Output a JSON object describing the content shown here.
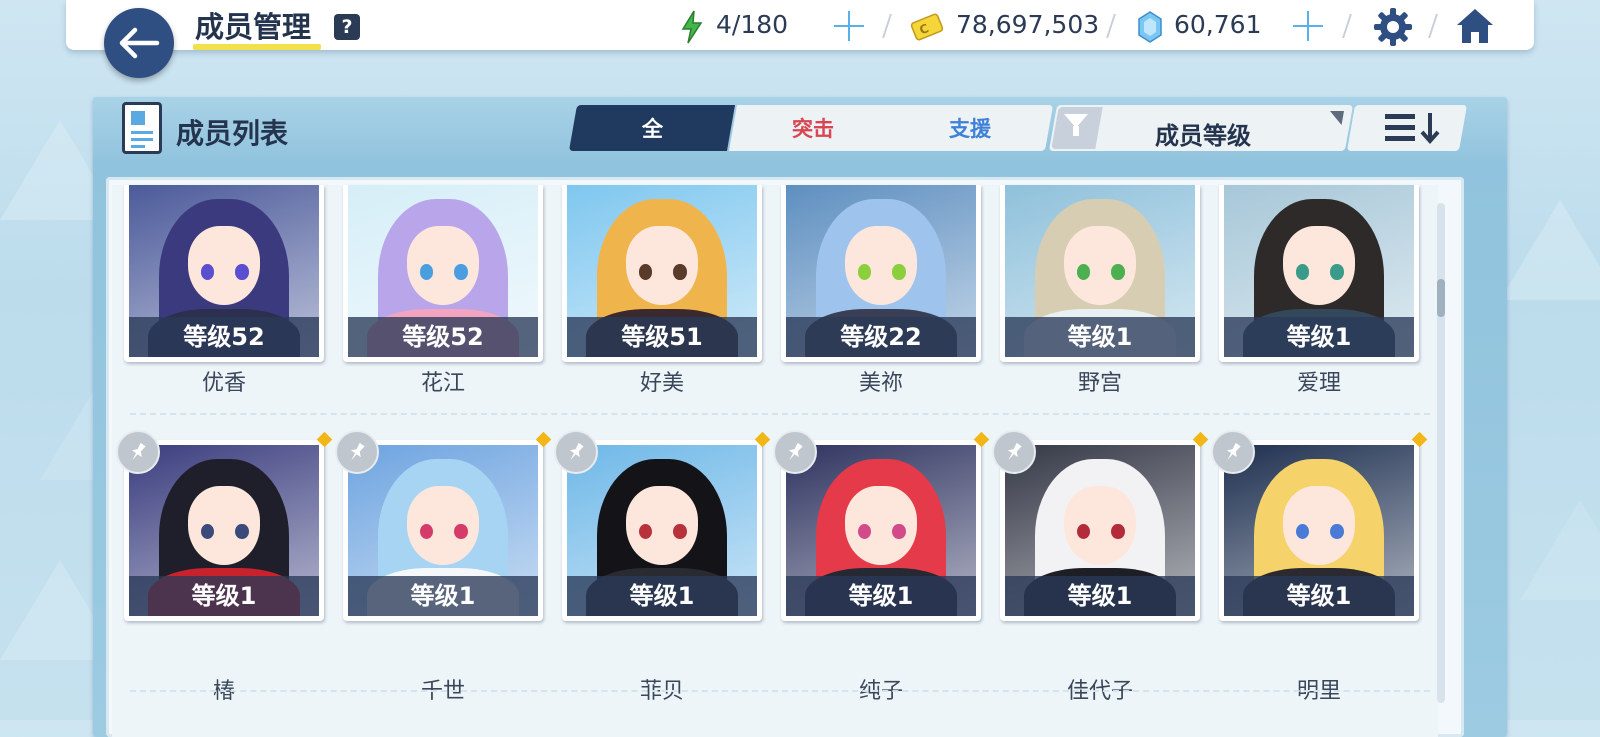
{
  "header": {
    "title": "成员管理",
    "help_label": "?",
    "ap": "4/180",
    "credits": "78,697,503",
    "pyroxene": "60,761"
  },
  "panel": {
    "title": "成员列表",
    "tabs": [
      {
        "label": "全",
        "active": true
      },
      {
        "label": "突击",
        "active": false
      },
      {
        "label": "支援",
        "active": false
      }
    ],
    "sort_label": "成员等级"
  },
  "students_row1": [
    {
      "name": "优香",
      "level": "等级52",
      "hair": "#3b3a7e",
      "outfit": "#2d2f4e",
      "eye": "#5a4fcf",
      "bg": "#4b5a9a"
    },
    {
      "name": "花江",
      "level": "等级52",
      "hair": "#b9a6ea",
      "outfit": "#f2a4c0",
      "eye": "#4a9ee0",
      "bg": "#d6eef8"
    },
    {
      "name": "好美",
      "level": "等级51",
      "hair": "#f0b44c",
      "outfit": "#3a2a30",
      "eye": "#5a3b2a",
      "bg": "#7fc7ef"
    },
    {
      "name": "美祢",
      "level": "等级22",
      "hair": "#9ec4ee",
      "outfit": "#3a3f55",
      "eye": "#8ccf3d",
      "bg": "#5e8fc0"
    },
    {
      "name": "野宫",
      "level": "等级1",
      "hair": "#d7cdb2",
      "outfit": "#e8f0f4",
      "eye": "#4caf50",
      "bg": "#8fc1db"
    },
    {
      "name": "爱理",
      "level": "等级1",
      "hair": "#2e2a2a",
      "outfit": "#34485c",
      "eye": "#3a9b8a",
      "bg": "#a7c7d8"
    }
  ],
  "students_row2": [
    {
      "name": "椿",
      "level": "等级1",
      "hair": "#1e1f2a",
      "outfit": "#c8232c",
      "eye": "#3a4a7a",
      "bg": "#3a3d7e"
    },
    {
      "name": "千世",
      "level": "等级1",
      "hair": "#a8d4f4",
      "outfit": "#f4f8fb",
      "eye": "#d43c6a",
      "bg": "#6ea4e0"
    },
    {
      "name": "菲贝",
      "level": "等级1",
      "hair": "#141418",
      "outfit": "#2a2a33",
      "eye": "#b8323c",
      "bg": "#6fb8e8"
    },
    {
      "name": "纯子",
      "level": "等级1",
      "hair": "#e43a4a",
      "outfit": "#262833",
      "eye": "#d24a8a",
      "bg": "#2f3460"
    },
    {
      "name": "佳代子",
      "level": "等级1",
      "hair": "#f2f2f4",
      "outfit": "#1e1e26",
      "eye": "#b32a3a",
      "bg": "#343846"
    },
    {
      "name": "明里",
      "level": "等级1",
      "hair": "#f6d26a",
      "outfit": "#2a2a30",
      "eye": "#4a7ad8",
      "bg": "#1e3050"
    }
  ]
}
